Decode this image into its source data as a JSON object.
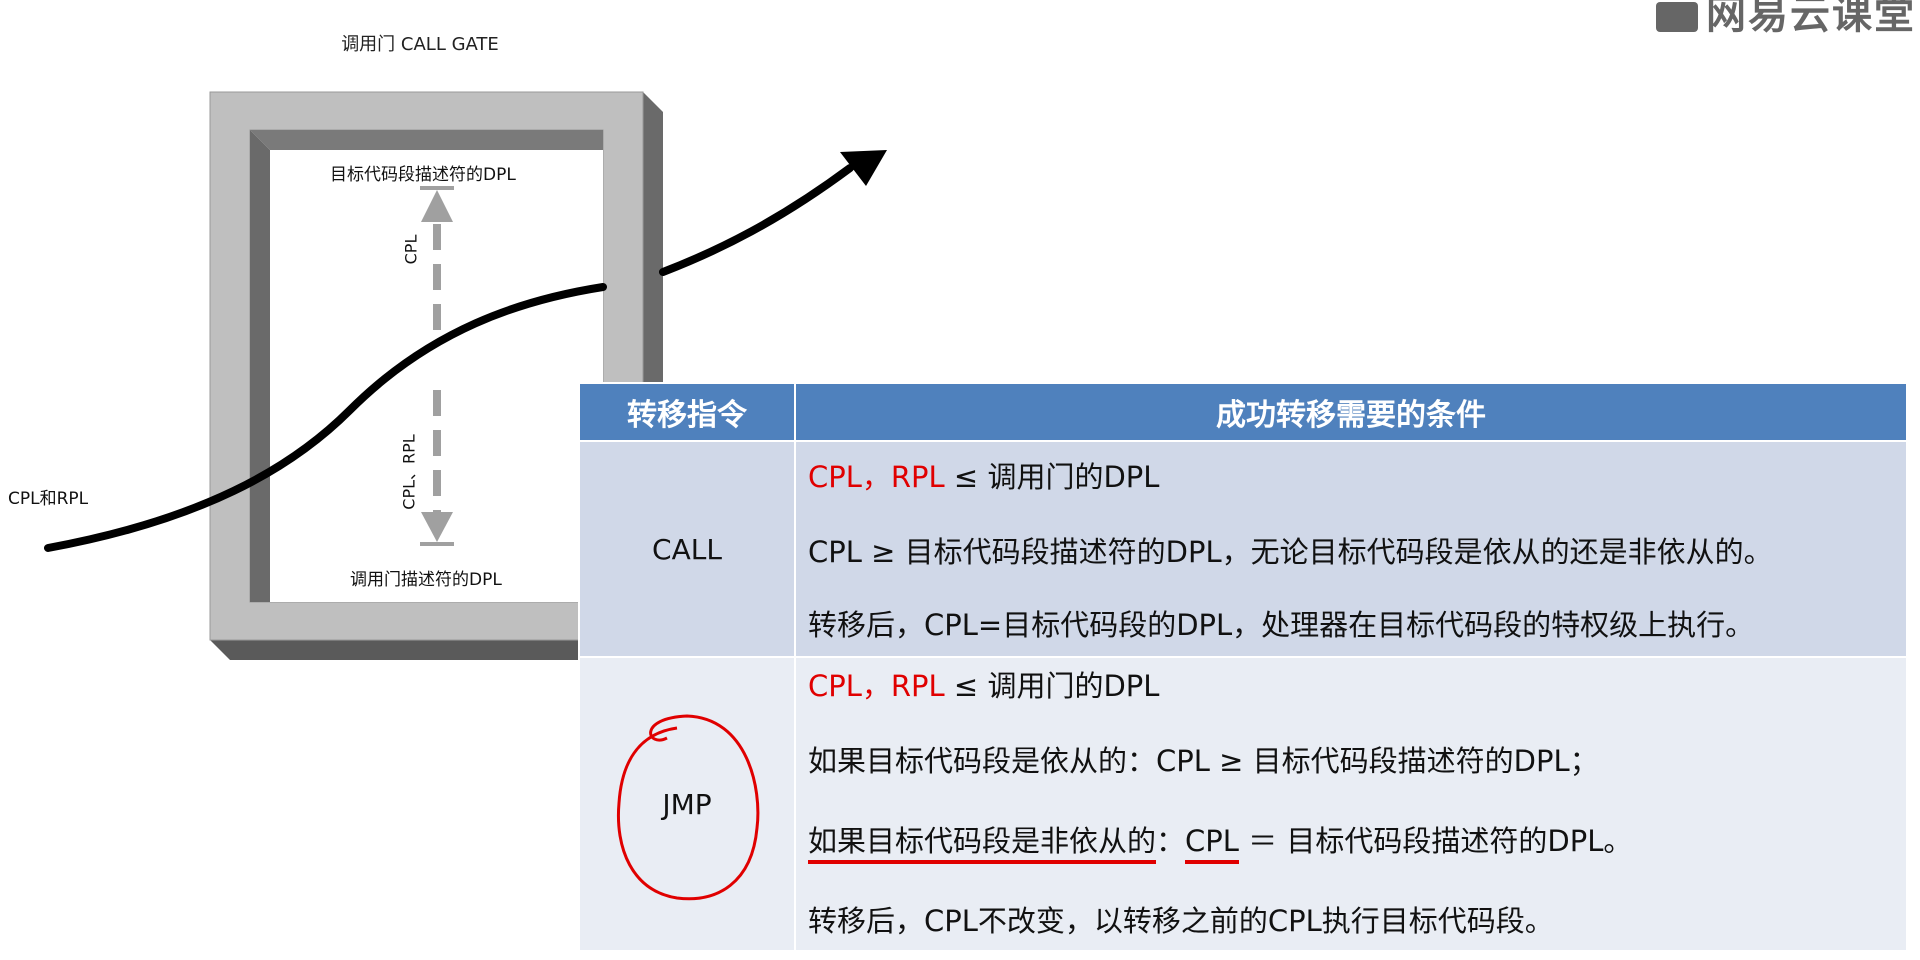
{
  "brand": {
    "text": "网易云课堂"
  },
  "diagram": {
    "title": "调用门 CALL GATE",
    "top_label": "目标代码段描述符的DPL",
    "bottom_label": "调用门描述符的DPL",
    "upper_vertical_label": "CPL",
    "lower_vertical_label": "CPL、RPL",
    "left_label": "CPL和RPL"
  },
  "table": {
    "headers": [
      "转移指令",
      "成功转移需要的条件"
    ],
    "call": {
      "instruction": "CALL",
      "line1_red": "CPL，RPL",
      "line1_rest": " ≤ 调用门的DPL",
      "line2": "CPL ≥ 目标代码段描述符的DPL，无论目标代码段是依从的还是非依从的。",
      "line3": "转移后，CPL=目标代码段的DPL，处理器在目标代码段的特权级上执行。"
    },
    "jmp": {
      "instruction": "JMP",
      "line1_red": "CPL，RPL",
      "line1_rest": " ≤ 调用门的DPL",
      "line2": "如果目标代码段是依从的：CPL ≥ 目标代码段描述符的DPL；",
      "line3_underlined": "如果目标代码段是非依从的",
      "line3_colon": "：",
      "line3_cpl": "CPL",
      "line3_rest": " ＝ 目标代码段描述符的DPL。",
      "line4": "转移后，CPL不改变，以转移之前的CPL执行目标代码段。"
    }
  },
  "colors": {
    "header": "#4f81bd",
    "row_call": "#d0d8e8",
    "row_jmp": "#e9edf4",
    "annotation": "#e00000"
  }
}
